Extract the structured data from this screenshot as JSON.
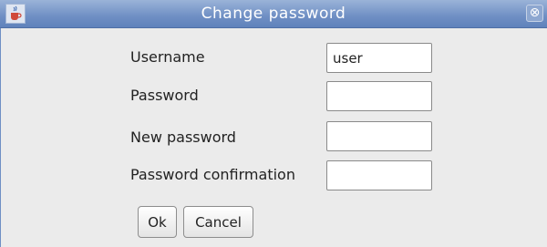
{
  "window": {
    "title": "Change password",
    "close_symbol": "⊗",
    "icon": "java-cup-icon"
  },
  "form": {
    "username_label": "Username",
    "username_value": "user",
    "password_label": "Password",
    "password_value": "",
    "new_password_label": "New password",
    "new_password_value": "",
    "confirmation_label": "Password confirmation",
    "confirmation_value": ""
  },
  "buttons": {
    "ok_label": "Ok",
    "cancel_label": "Cancel"
  },
  "colors": {
    "titlebar": "#6f8fc4",
    "background": "#ebebeb"
  }
}
